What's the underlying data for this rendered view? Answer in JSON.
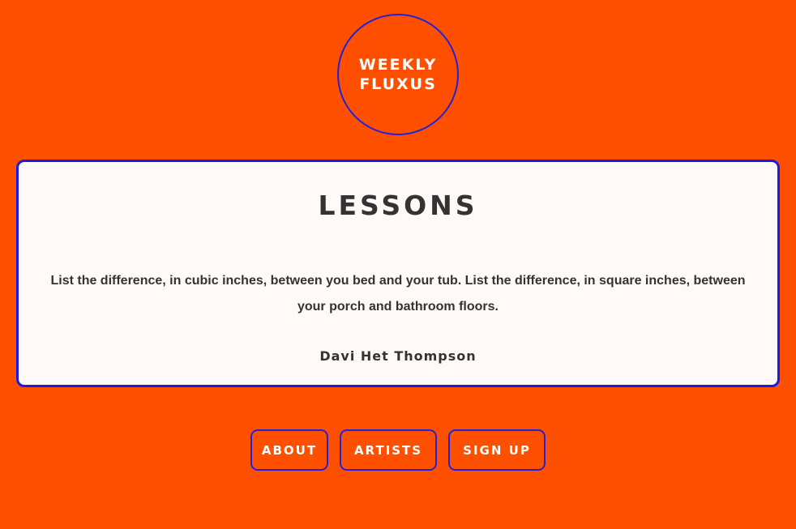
{
  "logo": {
    "line1": "WEEKLY",
    "line2": "FLUXUS"
  },
  "lesson": {
    "title": "LESSONS",
    "body": "List the difference, in cubic inches, between you bed and your tub. List the difference, in square inches, between your porch and bathroom floors.",
    "author": "Davi Het Thompson"
  },
  "nav": {
    "about": "ABOUT",
    "artists": "ARTISTS",
    "signup": "SIGN UP"
  },
  "colors": {
    "background": "#ff4f00",
    "accent_border": "#1a1ae0",
    "card_background": "#fffaf8",
    "text_dark": "#333333",
    "text_light": "#ffffff"
  }
}
